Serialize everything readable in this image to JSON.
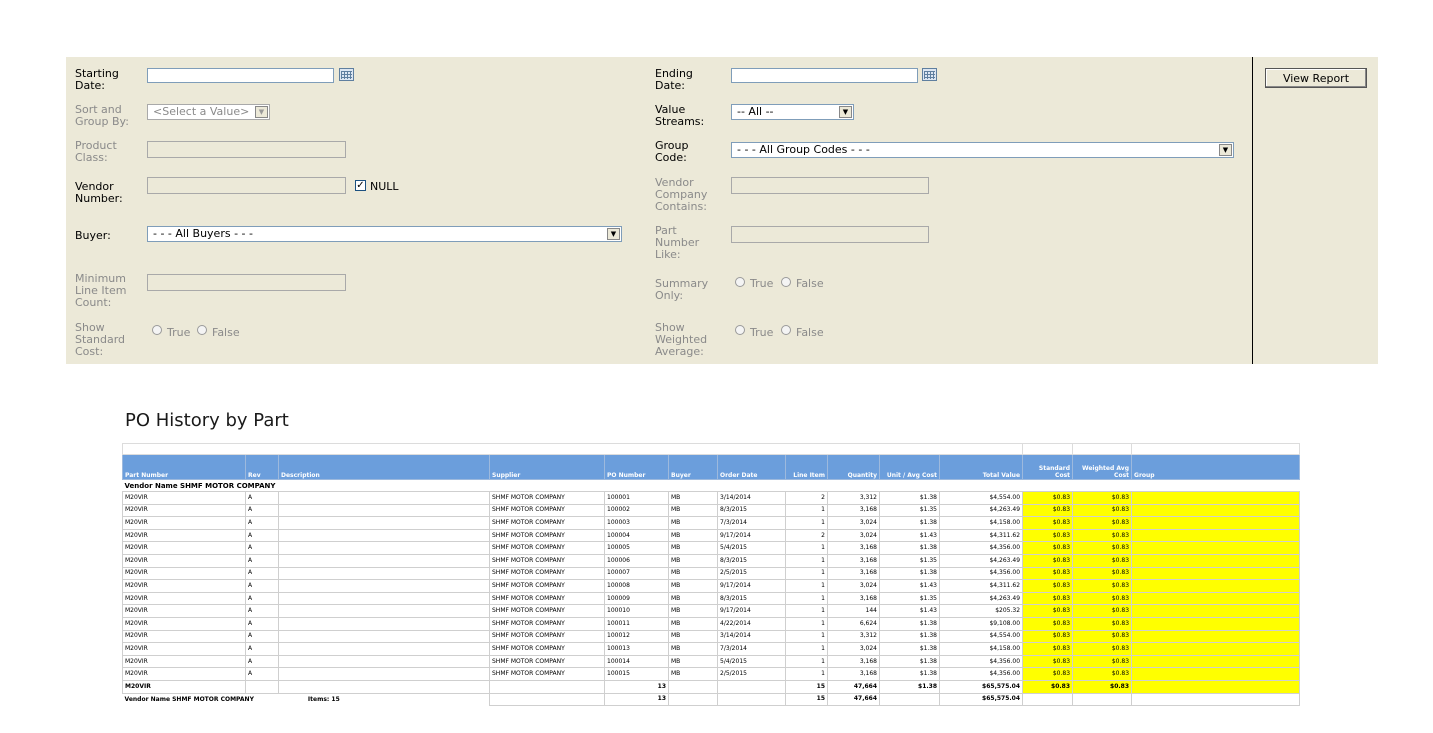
{
  "params": {
    "starting_date": {
      "label": "Starting\nDate:",
      "value": ""
    },
    "ending_date": {
      "label": "Ending\nDate:",
      "value": ""
    },
    "sort_group_by": {
      "label": "Sort and\nGroup By:",
      "value": "<Select a Value>"
    },
    "value_streams": {
      "label": "Value\nStreams:",
      "value": "-- All --"
    },
    "product_class": {
      "label": "Product\nClass:",
      "value": ""
    },
    "group_code": {
      "label": "Group\nCode:",
      "value": "- - - All Group Codes - - -"
    },
    "vendor_number": {
      "label": "Vendor\nNumber:",
      "value": "",
      "null_label": "NULL",
      "null_checked": true
    },
    "vendor_company": {
      "label": "Vendor\nCompany\nContains:",
      "value": ""
    },
    "buyer": {
      "label": "Buyer:",
      "value": "- - - All Buyers - - -"
    },
    "part_number_like": {
      "label": "Part\nNumber\nLike:",
      "value": ""
    },
    "min_line_item": {
      "label": "Minimum\nLine Item\nCount:",
      "value": ""
    },
    "summary_only": {
      "label": "Summary\nOnly:",
      "true_label": "True",
      "false_label": "False"
    },
    "show_standard_cost": {
      "label": "Show\nStandard\nCost:",
      "true_label": "True",
      "false_label": "False"
    },
    "show_weighted_avg": {
      "label": "Show\nWeighted\nAverage:",
      "true_label": "True",
      "false_label": "False"
    },
    "view_report": "View Report"
  },
  "report": {
    "title": "PO History by Part",
    "columns": [
      "Part Number",
      "Rev",
      "Description",
      "Supplier",
      "PO Number",
      "Buyer",
      "Order Date",
      "Line Item",
      "Quantity",
      "Unit / Avg Cost",
      "Total Value",
      "Standard Cost",
      "Weighted Avg Cost",
      "Group"
    ],
    "vendor_header": "Vendor Name  SHMF MOTOR COMPANY",
    "rows": [
      [
        "M20VIR",
        "A",
        "",
        "SHMF MOTOR COMPANY",
        "100001",
        "MB",
        "3/14/2014",
        "2",
        "3,312",
        "$1.38",
        "$4,554.00",
        "$0.83",
        "$0.83",
        ""
      ],
      [
        "M20VIR",
        "A",
        "",
        "SHMF MOTOR COMPANY",
        "100002",
        "MB",
        "8/3/2015",
        "1",
        "3,168",
        "$1.35",
        "$4,263.49",
        "$0.83",
        "$0.83",
        ""
      ],
      [
        "M20VIR",
        "A",
        "",
        "SHMF MOTOR COMPANY",
        "100003",
        "MB",
        "7/3/2014",
        "1",
        "3,024",
        "$1.38",
        "$4,158.00",
        "$0.83",
        "$0.83",
        ""
      ],
      [
        "M20VIR",
        "A",
        "",
        "SHMF MOTOR COMPANY",
        "100004",
        "MB",
        "9/17/2014",
        "2",
        "3,024",
        "$1.43",
        "$4,311.62",
        "$0.83",
        "$0.83",
        ""
      ],
      [
        "M20VIR",
        "A",
        "",
        "SHMF MOTOR COMPANY",
        "100005",
        "MB",
        "5/4/2015",
        "1",
        "3,168",
        "$1.38",
        "$4,356.00",
        "$0.83",
        "$0.83",
        ""
      ],
      [
        "M20VIR",
        "A",
        "",
        "SHMF MOTOR COMPANY",
        "100006",
        "MB",
        "8/3/2015",
        "1",
        "3,168",
        "$1.35",
        "$4,263.49",
        "$0.83",
        "$0.83",
        ""
      ],
      [
        "M20VIR",
        "A",
        "",
        "SHMF MOTOR COMPANY",
        "100007",
        "MB",
        "2/5/2015",
        "1",
        "3,168",
        "$1.38",
        "$4,356.00",
        "$0.83",
        "$0.83",
        ""
      ],
      [
        "M20VIR",
        "A",
        "",
        "SHMF MOTOR COMPANY",
        "100008",
        "MB",
        "9/17/2014",
        "1",
        "3,024",
        "$1.43",
        "$4,311.62",
        "$0.83",
        "$0.83",
        ""
      ],
      [
        "M20VIR",
        "A",
        "",
        "SHMF MOTOR COMPANY",
        "100009",
        "MB",
        "8/3/2015",
        "1",
        "3,168",
        "$1.35",
        "$4,263.49",
        "$0.83",
        "$0.83",
        ""
      ],
      [
        "M20VIR",
        "A",
        "",
        "SHMF MOTOR COMPANY",
        "100010",
        "MB",
        "9/17/2014",
        "1",
        "144",
        "$1.43",
        "$205.32",
        "$0.83",
        "$0.83",
        ""
      ],
      [
        "M20VIR",
        "A",
        "",
        "SHMF MOTOR COMPANY",
        "100011",
        "MB",
        "4/22/2014",
        "1",
        "6,624",
        "$1.38",
        "$9,108.00",
        "$0.83",
        "$0.83",
        ""
      ],
      [
        "M20VIR",
        "A",
        "",
        "SHMF MOTOR COMPANY",
        "100012",
        "MB",
        "3/14/2014",
        "1",
        "3,312",
        "$1.38",
        "$4,554.00",
        "$0.83",
        "$0.83",
        ""
      ],
      [
        "M20VIR",
        "A",
        "",
        "SHMF MOTOR COMPANY",
        "100013",
        "MB",
        "7/3/2014",
        "1",
        "3,024",
        "$1.38",
        "$4,158.00",
        "$0.83",
        "$0.83",
        ""
      ],
      [
        "M20VIR",
        "A",
        "",
        "SHMF MOTOR COMPANY",
        "100014",
        "MB",
        "5/4/2015",
        "1",
        "3,168",
        "$1.38",
        "$4,356.00",
        "$0.83",
        "$0.83",
        ""
      ],
      [
        "M20VIR",
        "A",
        "",
        "SHMF MOTOR COMPANY",
        "100015",
        "MB",
        "2/5/2015",
        "1",
        "3,168",
        "$1.38",
        "$4,356.00",
        "$0.83",
        "$0.83",
        ""
      ]
    ],
    "part_total": [
      "M20VIR",
      "",
      "",
      "",
      "13",
      "",
      "",
      "15",
      "47,664",
      "$1.38",
      "$65,575.04",
      "$0.83",
      "$0.83",
      ""
    ],
    "vendor_total": {
      "label": "Vendor Name  SHMF MOTOR COMPANY",
      "items": "Items: 15",
      "po_count": "13",
      "line_items": "15",
      "quantity": "47,664",
      "total_value": "$65,575.04"
    },
    "highlight_color": "#ffff00",
    "header_color": "#6b9edc"
  }
}
